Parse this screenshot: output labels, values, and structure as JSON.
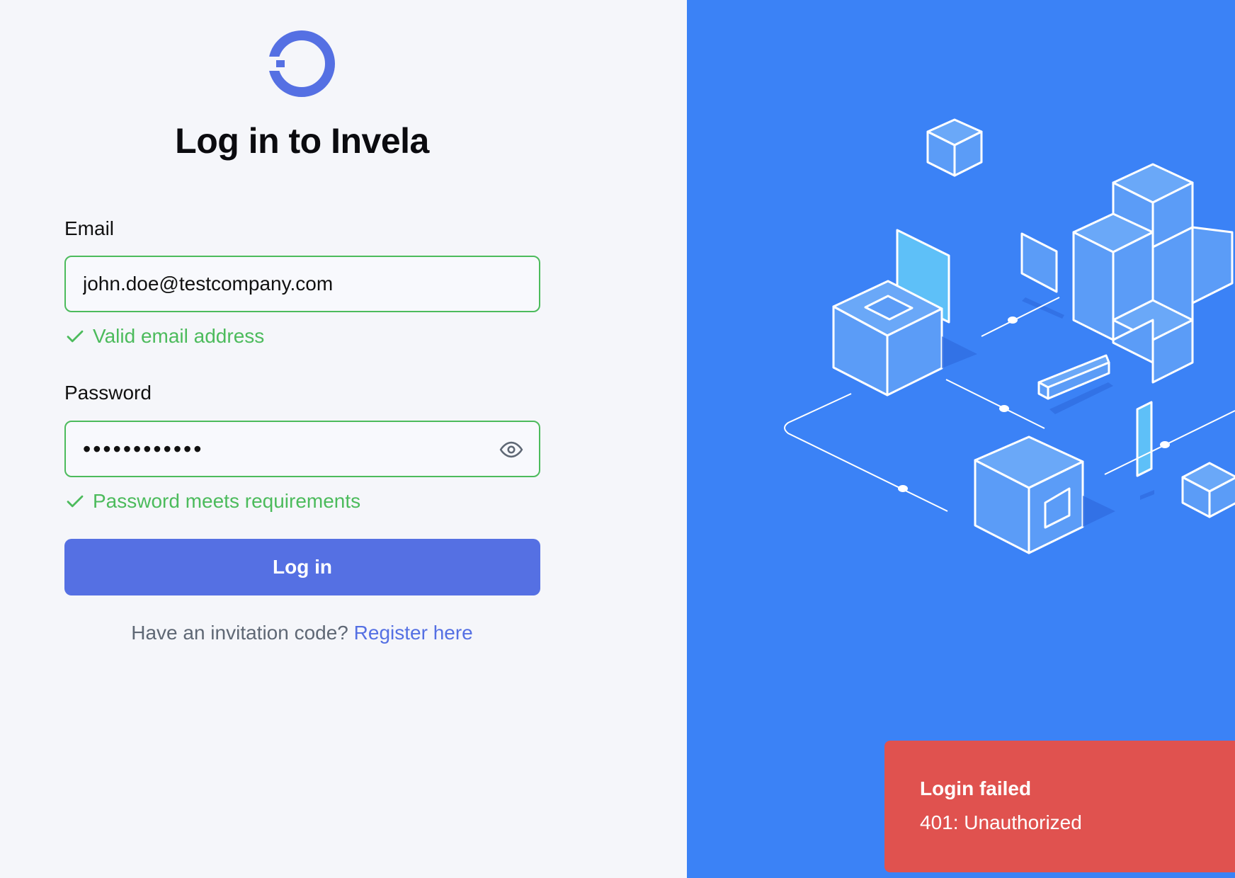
{
  "colors": {
    "accent": "#5570e3",
    "success": "#4cbb5c",
    "panel_blue": "#3b82f6",
    "error": "#e0524f",
    "background": "#f5f6fa"
  },
  "logo": {
    "icon": "invela-logo-icon"
  },
  "login": {
    "title": "Log in to Invela",
    "email": {
      "label": "Email",
      "value": "john.doe@testcompany.com",
      "validation": "Valid email address"
    },
    "password": {
      "label": "Password",
      "value": "••••••••••••",
      "validation": "Password meets requirements",
      "toggle_icon": "eye-icon"
    },
    "submit_label": "Log in",
    "register_prompt": "Have an invitation code?",
    "register_link": "Register here"
  },
  "toast": {
    "title": "Login failed",
    "message": "401: Unauthorized"
  }
}
